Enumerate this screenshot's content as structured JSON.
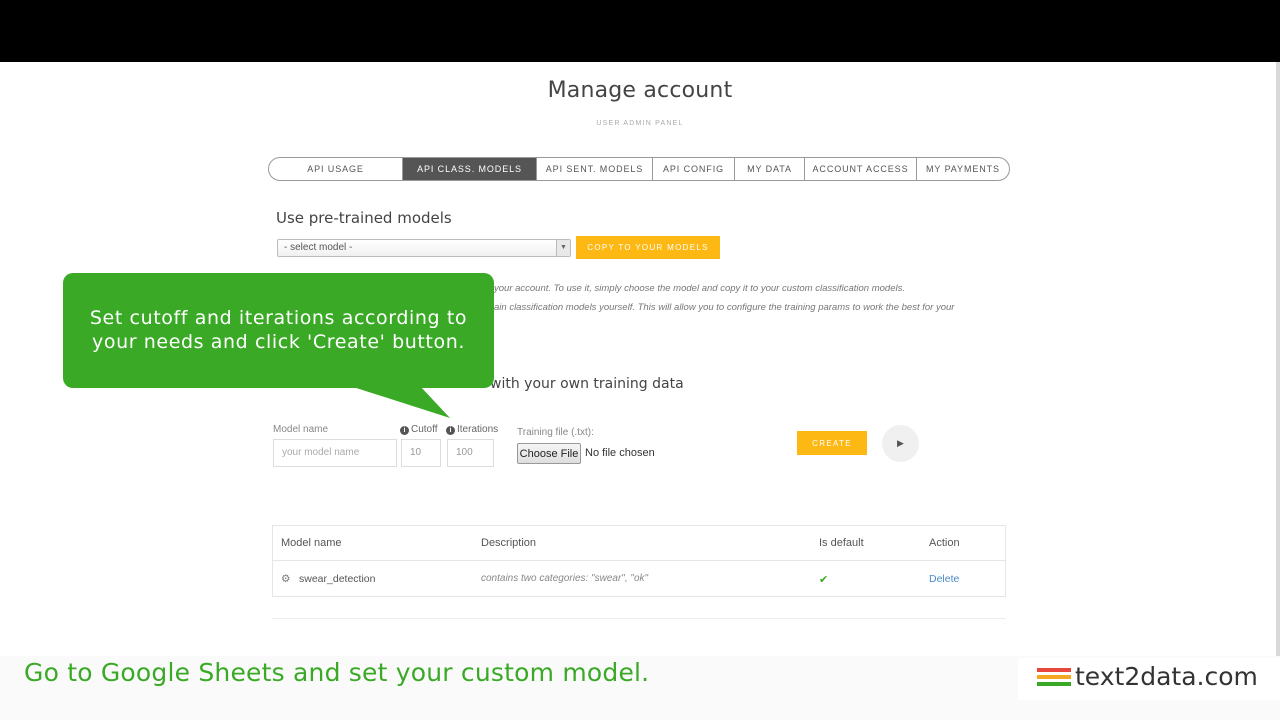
{
  "page": {
    "title": "Manage account",
    "subtitle": "USER ADMIN PANEL"
  },
  "tabs": [
    {
      "label": "API USAGE",
      "active": false
    },
    {
      "label": "API CLASS. MODELS",
      "active": true
    },
    {
      "label": "API SENT. MODELS",
      "active": false
    },
    {
      "label": "API CONFIG",
      "active": false
    },
    {
      "label": "MY DATA",
      "active": false
    },
    {
      "label": "ACCOUNT ACCESS",
      "active": false
    },
    {
      "label": "MY PAYMENTS",
      "active": false
    }
  ],
  "pretrained": {
    "heading": "Use pre-trained models",
    "select_value": "- select model -",
    "copy_button": "COPY TO YOUR MODELS",
    "info_line_1": "your account. To use it, simply choose the model and copy it to your custom classification models.",
    "info_line_2": "ain classification models yourself. This will allow you to configure the training params to work the best for your"
  },
  "callout": {
    "line_1": "Set cutoff and iterations according to",
    "line_2": "your needs and click 'Create' button."
  },
  "create_section": {
    "heading_visible": "with your own training data",
    "model_name_label": "Model name",
    "model_name_placeholder": "your model name",
    "cutoff_label": "Cutoff",
    "cutoff_value": "10",
    "iterations_label": "Iterations",
    "iterations_value": "100",
    "training_file_label": "Training file (.txt):",
    "choose_file_button": "Choose File",
    "file_status": "No file chosen",
    "create_button": "CREATE",
    "play_icon": "play-icon"
  },
  "models_table": {
    "columns": [
      "Model name",
      "Description",
      "Is default",
      "Action"
    ],
    "rows": [
      {
        "name": "swear_detection",
        "description": "contains two categories: \"swear\", \"ok\"",
        "is_default": "✔",
        "action": "Delete"
      }
    ]
  },
  "overlay": {
    "caption": "Go to Google Sheets and set your custom model.",
    "brand": "text2data.com",
    "brand_colors": [
      "#e8483b",
      "#f5a623",
      "#3aaa26"
    ]
  },
  "colors": {
    "accent_yellow": "#fdb813",
    "callout_green": "#3aaa26",
    "active_tab": "#555555",
    "link_blue": "#4a8ac9"
  }
}
